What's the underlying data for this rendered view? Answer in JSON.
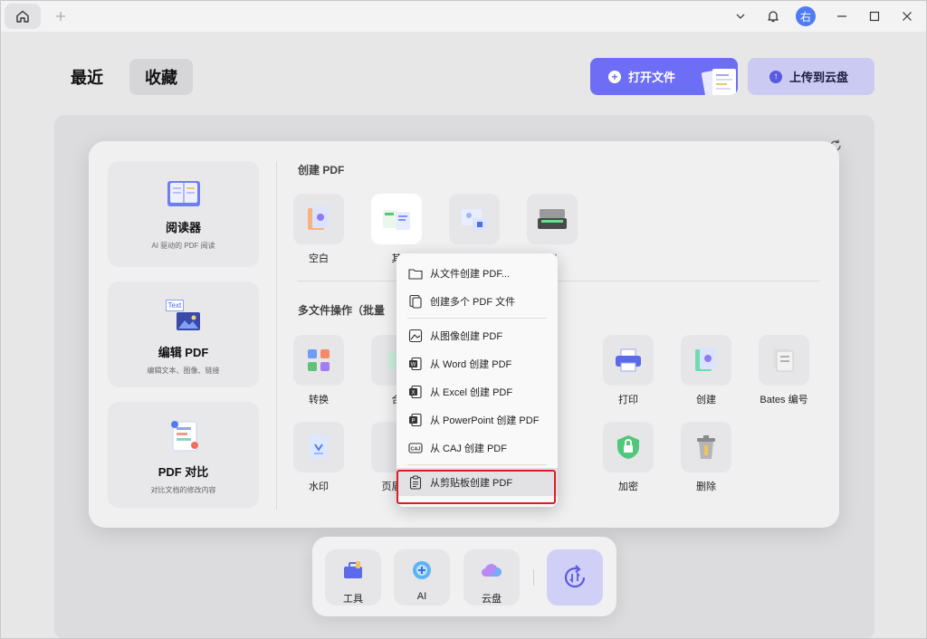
{
  "titlebar": {
    "avatar_text": "右"
  },
  "nav": {
    "recent": "最近",
    "favorites": "收藏"
  },
  "actions": {
    "open_file": "打开文件",
    "upload_cloud": "上传到云盘"
  },
  "sidebar": {
    "reader": {
      "title": "阅读器",
      "subtitle": "AI 驱动的 PDF 阅读"
    },
    "edit": {
      "title": "编辑 PDF",
      "subtitle": "编辑文本、图像、链接",
      "badge": "Text"
    },
    "compare": {
      "title": "PDF 对比",
      "subtitle": "对比文档的修改内容"
    }
  },
  "create_section": {
    "title": "创建 PDF",
    "tools": [
      {
        "label": "空白"
      },
      {
        "label": "其"
      },
      {
        "label": ""
      },
      {
        "label": "仪"
      }
    ]
  },
  "batch_section": {
    "title": "多文件操作（批量",
    "tools_row1": [
      {
        "label": "转换"
      },
      {
        "label": "合"
      },
      {
        "label": "打印"
      },
      {
        "label": "创建"
      },
      {
        "label": "Bates 编号"
      }
    ],
    "tools_row2": [
      {
        "label": "水印"
      },
      {
        "label": "页眉和"
      },
      {
        "label": "加密"
      },
      {
        "label": "删除"
      }
    ]
  },
  "dropdown": {
    "items": [
      {
        "label": "从文件创建 PDF..."
      },
      {
        "label": "创建多个 PDF 文件"
      },
      {
        "label": "从图像创建 PDF"
      },
      {
        "label": "从 Word 创建 PDF"
      },
      {
        "label": "从 Excel 创建 PDF"
      },
      {
        "label": "从 PowerPoint 创建 PDF"
      },
      {
        "label": "从 CAJ 创建 PDF"
      },
      {
        "label": "从剪贴板创建 PDF"
      }
    ]
  },
  "bottom_bar": {
    "tools": "工具",
    "ai": "AI",
    "cloud": "云盘"
  },
  "colors": {
    "accent": "#6d6df6",
    "highlight": "#e01b24",
    "cloud_button": "#cbcaf2"
  }
}
